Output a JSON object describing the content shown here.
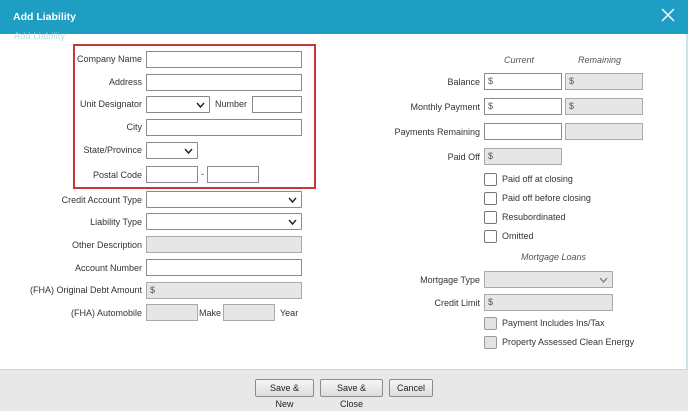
{
  "dialog": {
    "title": "Add Liability",
    "ghost_text": "Add Liability",
    "close_icon": "close-icon"
  },
  "left": {
    "company_name_label": "Company Name",
    "address_label": "Address",
    "unit_designator_label": "Unit Designator",
    "number_label": "Number",
    "city_label": "City",
    "state_label": "State/Province",
    "postal_code_label": "Postal Code",
    "postal_sep": "-",
    "credit_account_type_label": "Credit Account Type",
    "liability_type_label": "Liability Type",
    "other_description_label": "Other Description",
    "account_number_label": "Account Number",
    "fha_original_debt_label": "(FHA) Original Debt Amount",
    "fha_original_debt_prefix": "$",
    "fha_automobile_label": "(FHA) Automobile",
    "make_label": "Make",
    "year_label": "Year"
  },
  "right": {
    "current_header": "Current",
    "remaining_header": "Remaining",
    "balance_label": "Balance",
    "monthly_payment_label": "Monthly Payment",
    "payments_remaining_label": "Payments Remaining",
    "paid_off_label": "Paid Off",
    "currency_prefix": "$",
    "checkboxes": {
      "paid_off_at_closing": "Paid off at closing",
      "paid_off_before_closing": "Paid off before closing",
      "resubordinated": "Resubordinated",
      "omitted": "Omitted"
    },
    "mortgage_loans_header": "Mortgage Loans",
    "mortgage_type_label": "Mortgage Type",
    "credit_limit_label": "Credit Limit",
    "payment_includes_label": "Payment Includes Ins/Tax",
    "pace_label": "Property Assessed Clean Energy"
  },
  "footer": {
    "save_new": "Save & New",
    "save_close": "Save & Close",
    "cancel": "Cancel"
  },
  "colors": {
    "titlebar": "#1d9ec2",
    "highlight": "#c8383a"
  }
}
